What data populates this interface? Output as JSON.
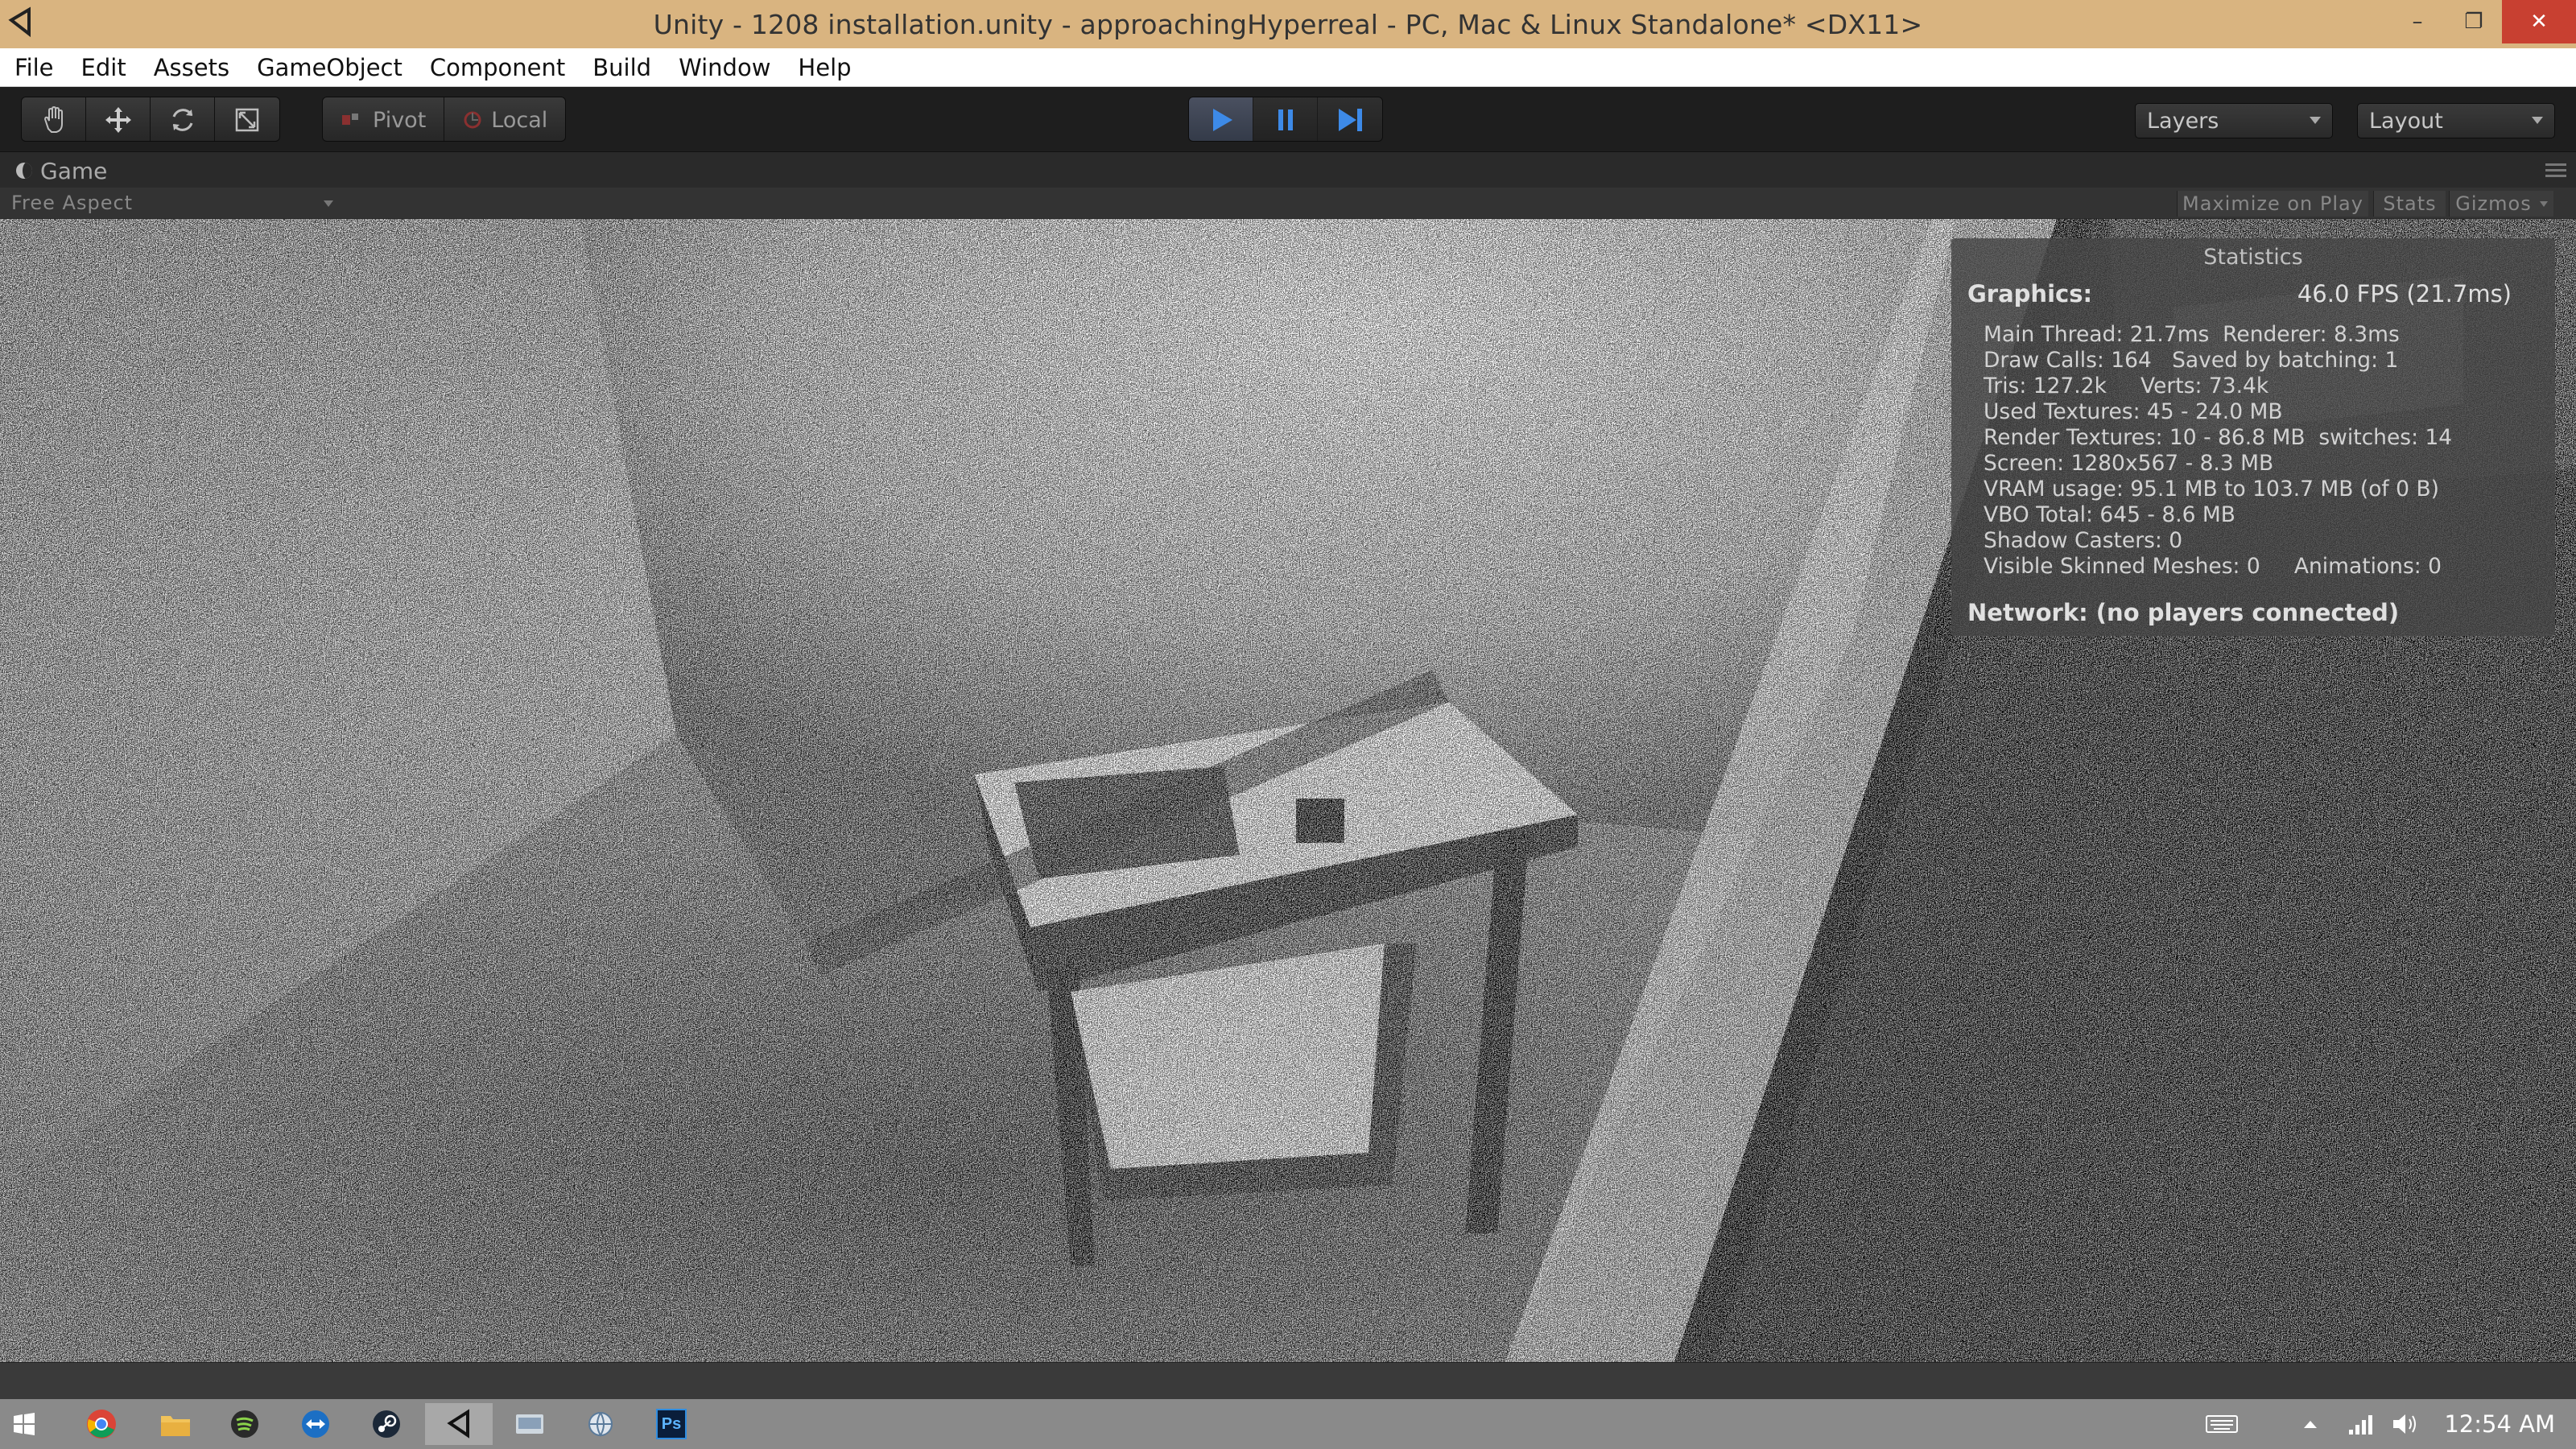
{
  "window": {
    "title": "Unity - 1208 installation.unity - approachingHyperreal - PC, Mac & Linux Standalone* <DX11>",
    "minimize": "–",
    "restore": "❐",
    "close": "✕"
  },
  "menu": [
    "File",
    "Edit",
    "Assets",
    "GameObject",
    "Component",
    "Build",
    "Window",
    "Help"
  ],
  "toolbar": {
    "tools": [
      "hand-icon",
      "move-icon",
      "rotate-icon",
      "scale-icon"
    ],
    "pivot_label": "Pivot",
    "local_label": "Local",
    "play_controls": [
      "play-icon",
      "pause-icon",
      "step-icon"
    ],
    "layers_label": "Layers",
    "layout_label": "Layout"
  },
  "game_panel": {
    "tab_label": "Game",
    "aspect": "Free Aspect",
    "maximize_on_play": "Maximize on Play",
    "stats": "Stats",
    "gizmos": "Gizmos"
  },
  "statistics": {
    "title": "Statistics",
    "graphics_label": "Graphics:",
    "fps": "46.0 FPS (21.7ms)",
    "lines": [
      "Main Thread: 21.7ms  Renderer: 8.3ms",
      "Draw Calls: 164   Saved by batching: 1",
      "Tris: 127.2k     Verts: 73.4k",
      "Used Textures: 45 - 24.0 MB",
      "Render Textures: 10 - 86.8 MB  switches: 14",
      "Screen: 1280x567 - 8.3 MB",
      "VRAM usage: 95.1 MB to 103.7 MB (of 0 B)",
      "VBO Total: 645 - 8.6 MB",
      "Shadow Casters: 0",
      "Visible Skinned Meshes: 0     Animations: 0"
    ],
    "network": "Network: (no players connected)"
  },
  "taskbar": {
    "apps": [
      "windows-start-icon",
      "chrome-icon",
      "file-explorer-icon",
      "spotify-icon",
      "teamviewer-icon",
      "steam-icon",
      "unity-icon",
      "app-icon",
      "network-app-icon",
      "photoshop-icon"
    ],
    "photoshop_text": "Ps",
    "clock": "12:54 AM"
  },
  "colors": {
    "titlebar": "#d9b480",
    "close": "#c84031",
    "toolbar": "#1e1e1e",
    "play_active": "#3d8ae8",
    "taskbar": "#8a8a8a"
  }
}
